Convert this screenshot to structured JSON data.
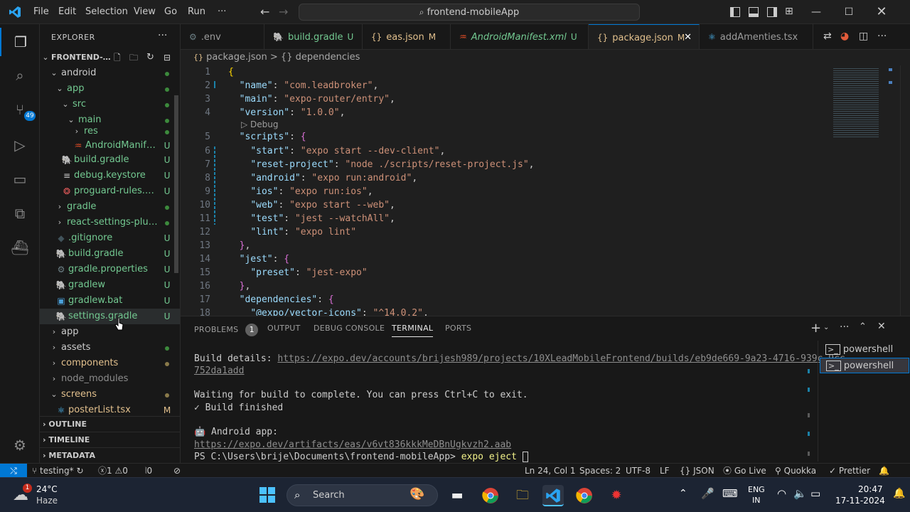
{
  "titlebar": {
    "menus": [
      "File",
      "Edit",
      "Selection",
      "View",
      "Go",
      "Run",
      "···"
    ],
    "search": "frontend-mobileApp"
  },
  "activity": {
    "scm_badge": "49"
  },
  "explorer": {
    "title": "EXPLORER",
    "root": "FRONTEND-M...",
    "items": [
      {
        "label": "android",
        "status": "dot",
        "color": "#cccccc"
      },
      {
        "label": "app",
        "status": "dot",
        "color": "#73c991"
      },
      {
        "label": "src",
        "status": "dot",
        "color": "#73c991"
      },
      {
        "label": "main",
        "status": "dot",
        "color": "#73c991"
      },
      {
        "label": "res",
        "status": "dot",
        "color": "#73c991"
      },
      {
        "label": "AndroidManifes...",
        "status": "U",
        "color": "#73c991"
      },
      {
        "label": "build.gradle",
        "status": "U",
        "color": "#73c991"
      },
      {
        "label": "debug.keystore",
        "status": "U",
        "color": "#73c991"
      },
      {
        "label": "proguard-rules.pro",
        "status": "U",
        "color": "#73c991"
      },
      {
        "label": "gradle",
        "status": "dot",
        "color": "#73c991"
      },
      {
        "label": "react-settings-plugin",
        "status": "dot",
        "color": "#73c991"
      },
      {
        "label": ".gitignore",
        "status": "U",
        "color": "#73c991"
      },
      {
        "label": "build.gradle",
        "status": "U",
        "color": "#73c991"
      },
      {
        "label": "gradle.properties",
        "status": "U",
        "color": "#73c991"
      },
      {
        "label": "gradlew",
        "status": "U",
        "color": "#73c991"
      },
      {
        "label": "gradlew.bat",
        "status": "U",
        "color": "#73c991"
      },
      {
        "label": "settings.gradle",
        "status": "U",
        "color": "#73c991"
      },
      {
        "label": "app",
        "status": "",
        "color": "#cccccc"
      },
      {
        "label": "assets",
        "status": "dot",
        "color": "#cccccc"
      },
      {
        "label": "components",
        "status": "dot",
        "color": "#e2c08d"
      },
      {
        "label": "node_modules",
        "status": "",
        "color": "#8c8c8c"
      },
      {
        "label": "screens",
        "status": "dot",
        "color": "#e2c08d"
      },
      {
        "label": "posterList.tsx",
        "status": "M",
        "color": "#e2c08d"
      }
    ],
    "sections": [
      "OUTLINE",
      "TIMELINE",
      "METADATA"
    ]
  },
  "tabs": [
    {
      "icon": "⚙",
      "label": ".env",
      "status": ""
    },
    {
      "icon": "🐘",
      "label": "build.gradle",
      "status": "U"
    },
    {
      "icon": "{}",
      "label": "eas.json",
      "status": "M"
    },
    {
      "icon": "♒",
      "label": "AndroidManifest.xml",
      "status": "U"
    },
    {
      "icon": "{}",
      "label": "package.json",
      "status": "M"
    },
    {
      "icon": "⚛",
      "label": "addAmenties.tsx",
      "status": ""
    }
  ],
  "breadcrumb": {
    "file": "package.json",
    "sep": ">",
    "symbol": "{} dependencies"
  },
  "editor": {
    "codelens": "Debug",
    "line_numbers": [
      "1",
      "2",
      "3",
      "4",
      "5",
      "6",
      "7",
      "8",
      "9",
      "10",
      "11",
      "12",
      "13",
      "14",
      "15",
      "16",
      "17",
      "18"
    ]
  },
  "panel": {
    "tabs": [
      "PROBLEMS",
      "OUTPUT",
      "DEBUG CONSOLE",
      "TERMINAL",
      "PORTS"
    ],
    "problems_count": "1",
    "terminal": {
      "build_label": "Build details: ",
      "build_link_1": "https://expo.dev/accounts/brijesh989/projects/10XLeadMobileFrontend/builds/eb9de669-9a23-4716-939c-9cc",
      "build_link_2": "752da1add",
      "waiting": "Waiting for build to complete. You can press Ctrl+C to exit.",
      "finished": "✓ Build finished",
      "android": "🤖 Android app:",
      "artifact": "https://expo.dev/artifacts/eas/v6vt836kkkMeDBnUgkvzh2.aab",
      "prompt": "PS C:\\Users\\brije\\Documents\\frontend-mobileApp> ",
      "command": "expo eject "
    },
    "terminals": [
      "powershell",
      "powershell"
    ]
  },
  "statusbar": {
    "branch": "testing*",
    "errors": "1",
    "warnings": "0",
    "ports": "0",
    "position": "Ln 24, Col 1",
    "spaces": "Spaces: 2",
    "encoding": "UTF-8",
    "eol": "LF",
    "language": "JSON",
    "golive": "Go Live",
    "quokka": "Quokka",
    "prettier": "Prettier"
  },
  "taskbar": {
    "weather_temp": "24°C",
    "weather_desc": "Haze",
    "weather_badge": "1",
    "search": "Search",
    "lang1": "ENG",
    "lang2": "IN",
    "time": "20:47",
    "date": "17-11-2024"
  }
}
